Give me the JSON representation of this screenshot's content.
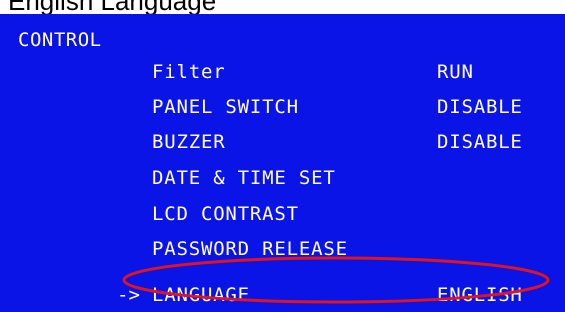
{
  "caption": {
    "text": "English Language"
  },
  "screen": {
    "title": "CONTROL",
    "background_color": "#0a14e6",
    "text_color": "#ffffff",
    "cursor": "->",
    "items": [
      {
        "label": "Filter",
        "value": "RUN"
      },
      {
        "label": "PANEL SWITCH",
        "value": "DISABLE"
      },
      {
        "label": "BUZZER",
        "value": "DISABLE"
      },
      {
        "label": "DATE & TIME SET",
        "value": ""
      },
      {
        "label": "LCD CONTRAST",
        "value": ""
      },
      {
        "label": "PASSWORD RELEASE",
        "value": ""
      },
      {
        "label": "LANGUAGE",
        "value": "ENGLISH"
      }
    ],
    "selected_index": 6
  },
  "annotation": {
    "color": "#e0141e",
    "icon": "red-highlight-ellipse"
  }
}
